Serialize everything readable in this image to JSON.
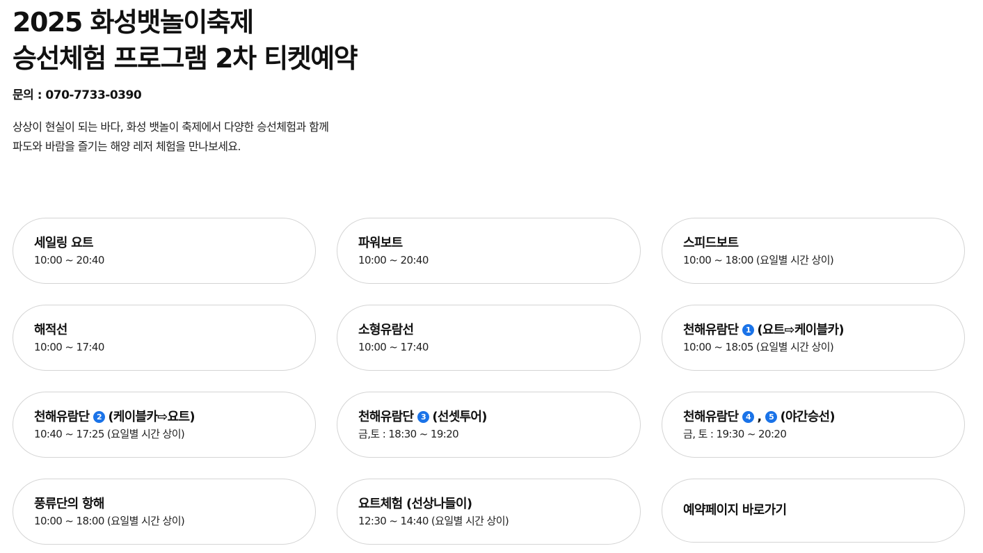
{
  "header": {
    "title_line1": "2025 화성뱃놀이축제",
    "title_line2": "승선체험 프로그램 2차 티켓예약",
    "contact": "문의 : 070-7733-0390",
    "intro_line1": "상상이 현실이 되는 바다, 화성 뱃놀이 축제에서 다양한 승선체험과 함께",
    "intro_line2": "파도와 바람을 즐기는 해양 레저 체험을 만나보세요."
  },
  "programs": [
    {
      "title": "세일링 요트",
      "time": "10:00 ~ 20:40"
    },
    {
      "title": "파워보트",
      "time": "10:00 ~ 20:40"
    },
    {
      "title": "스피드보트",
      "time": "10:00 ~ 18:00 (요일별 시간 상이)"
    },
    {
      "title": "해적선",
      "time": "10:00 ~ 17:40"
    },
    {
      "title": "소형유람선",
      "time": "10:00 ~ 17:40"
    },
    {
      "title_prefix": "천해유람단",
      "badges": [
        "1"
      ],
      "title_suffix": "(요트⇨케이블카)",
      "time": "10:00 ~ 18:05 (요일별 시간 상이)"
    },
    {
      "title_prefix": "천해유람단",
      "badges": [
        "2"
      ],
      "title_suffix": "(케이블카⇨요트)",
      "time": "10:40 ~ 17:25 (요일별 시간 상이)"
    },
    {
      "title_prefix": "천해유람단",
      "badges": [
        "3"
      ],
      "title_suffix": "(선셋투어)",
      "time": "금,토 : 18:30 ~ 19:20"
    },
    {
      "title_prefix": "천해유람단",
      "badges": [
        "4",
        "5"
      ],
      "separator": ",",
      "title_suffix": "(야간승선)",
      "time": "금, 토 : 19:30 ~ 20:20"
    },
    {
      "title": "풍류단의 항해",
      "time": "10:00 ~ 18:00 (요일별 시간 상이)"
    },
    {
      "title": "요트체험 (선상나들이)",
      "time": "12:30 ~ 14:40 (요일별 시간 상이)"
    }
  ],
  "reserve_link": {
    "label": "예약페이지 바로가기"
  },
  "colors": {
    "badge": "#1a73e8",
    "border": "#d4d4d4",
    "text": "#111111"
  }
}
